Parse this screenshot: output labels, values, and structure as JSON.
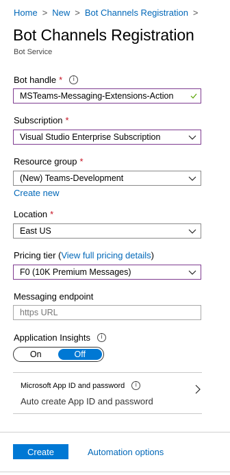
{
  "breadcrumb": [
    "Home",
    "New",
    "Bot Channels Registration"
  ],
  "header": {
    "title": "Bot Channels Registration",
    "subtitle": "Bot Service"
  },
  "form": {
    "bot_handle": {
      "label": "Bot handle",
      "required": "*",
      "value": "MSTeams-Messaging-Extensions-Action"
    },
    "subscription": {
      "label": "Subscription",
      "required": "*",
      "value": "Visual Studio Enterprise Subscription"
    },
    "resource_group": {
      "label": "Resource group",
      "required": "*",
      "value": "(New) Teams-Development",
      "create_new": "Create new"
    },
    "location": {
      "label": "Location",
      "required": "*",
      "value": "East US"
    },
    "pricing_tier": {
      "label_prefix": "Pricing tier (",
      "link": "View full pricing details",
      "label_suffix": ")",
      "value": "F0 (10K Premium Messages)"
    },
    "messaging_endpoint": {
      "label": "Messaging endpoint",
      "placeholder": "https URL"
    },
    "app_insights": {
      "label": "Application Insights",
      "on": "On",
      "off": "Off",
      "selected": "Off"
    },
    "app_id": {
      "title": "Microsoft App ID and password",
      "value": "Auto create App ID and password"
    }
  },
  "footer": {
    "create": "Create",
    "automation": "Automation options"
  },
  "colors": {
    "accent": "#0078d4",
    "link": "#0067b8",
    "required": "#c50f1f",
    "focus_border": "#7d3a8f",
    "valid_check": "#57a300"
  }
}
